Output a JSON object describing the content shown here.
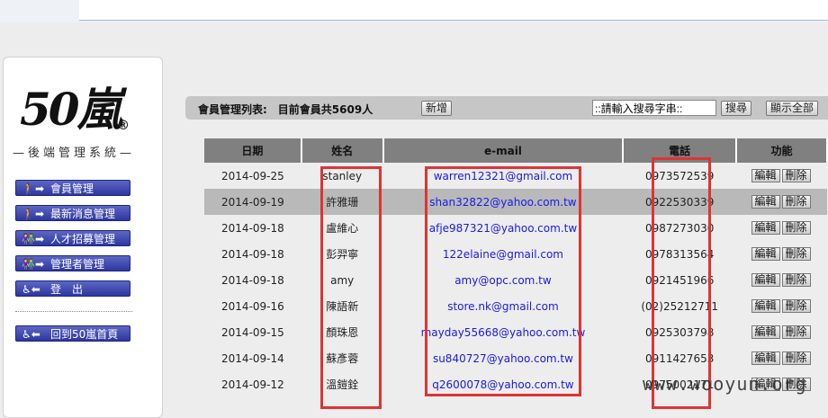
{
  "logo": {
    "text": "50嵐",
    "reg": "®",
    "subtitle": "—後端管理系統—"
  },
  "menu": {
    "items": [
      {
        "icon": "🚶➡",
        "label": "會員管理"
      },
      {
        "icon": "🚶➡",
        "label": "最新消息管理"
      },
      {
        "icon": "👫➡",
        "label": "人才招募管理"
      },
      {
        "icon": "👫➡",
        "label": "管理者管理"
      },
      {
        "icon": "♿⬅",
        "label": "登　出"
      }
    ],
    "home": {
      "icon": "♿⬅",
      "label": "回到50嵐首頁"
    }
  },
  "toolbar": {
    "title": "會員管理列表:　目前會員共5609人",
    "add_label": "新增",
    "search_value": "::請輸入搜尋字串::",
    "search_label": "搜尋",
    "show_all_label": "顯示全部"
  },
  "table": {
    "headers": [
      "日期",
      "姓名",
      "e-mail",
      "電話",
      "功能"
    ],
    "edit_label": "編輯",
    "delete_label": "刪除",
    "rows": [
      {
        "date": "2014-09-25",
        "name": "stanley",
        "email": "warren12321@gmail.com",
        "phone": "0973572539"
      },
      {
        "date": "2014-09-19",
        "name": "許雅珊",
        "email": "shan32822@yahoo.com.tw",
        "phone": "0922530339"
      },
      {
        "date": "2014-09-18",
        "name": "盧維心",
        "email": "afje987321@yahoo.com.tw",
        "phone": "0987273030"
      },
      {
        "date": "2014-09-18",
        "name": "彭羿寧",
        "email": "122elaine@gmail.com",
        "phone": "0978313564"
      },
      {
        "date": "2014-09-18",
        "name": "amy",
        "email": "amy@opc.com.tw",
        "phone": "0921451966"
      },
      {
        "date": "2014-09-16",
        "name": "陳語新",
        "email": "store.nk@gmail.com",
        "phone": "(02)25212711"
      },
      {
        "date": "2014-09-15",
        "name": "顏珠恩",
        "email": "mayday55668@yahoo.com.tw",
        "phone": "0925303798"
      },
      {
        "date": "2014-09-14",
        "name": "蘇彥蓉",
        "email": "su840727@yahoo.com.tw",
        "phone": "0911427653"
      },
      {
        "date": "2014-09-12",
        "name": "溫鎧銓",
        "email": "q2600078@yahoo.com.tw",
        "phone": "0975002171"
      }
    ]
  },
  "watermark": "www.wooyun.org",
  "colors": {
    "header_bg": "#808080",
    "highlight_row": "#b9b9b9",
    "menu_button": "#3a43aa",
    "link": "#1a1ae6",
    "annotation_box": "#e03333"
  }
}
